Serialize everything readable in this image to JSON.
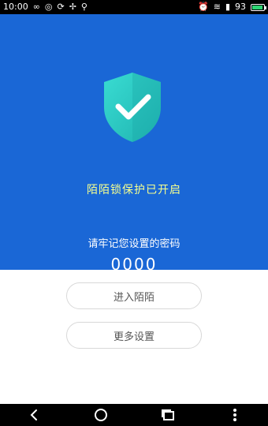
{
  "status_bar": {
    "time": "10:00",
    "battery_level": "93",
    "battery_fill_fraction": 0.93,
    "left_icons": [
      "infinity-icon",
      "app-icon",
      "sync-icon",
      "pinwheel-icon",
      "usb-icon"
    ],
    "right_icons": [
      "alarm-icon",
      "wifi-icon",
      "signal-icon",
      "battery-icon"
    ]
  },
  "hero": {
    "title": "陌陌锁保护已开启",
    "remember_label": "请牢记您设置的密码",
    "password": "0000",
    "colors": {
      "background": "#1a67d6",
      "title": "#f5ff8f",
      "shield": "#2bc9c3"
    }
  },
  "actions": {
    "enter_label": "进入陌陌",
    "more_settings_label": "更多设置"
  },
  "nav_bar": {
    "icons": [
      "back-icon",
      "home-icon",
      "recent-apps-icon",
      "more-icon"
    ]
  }
}
